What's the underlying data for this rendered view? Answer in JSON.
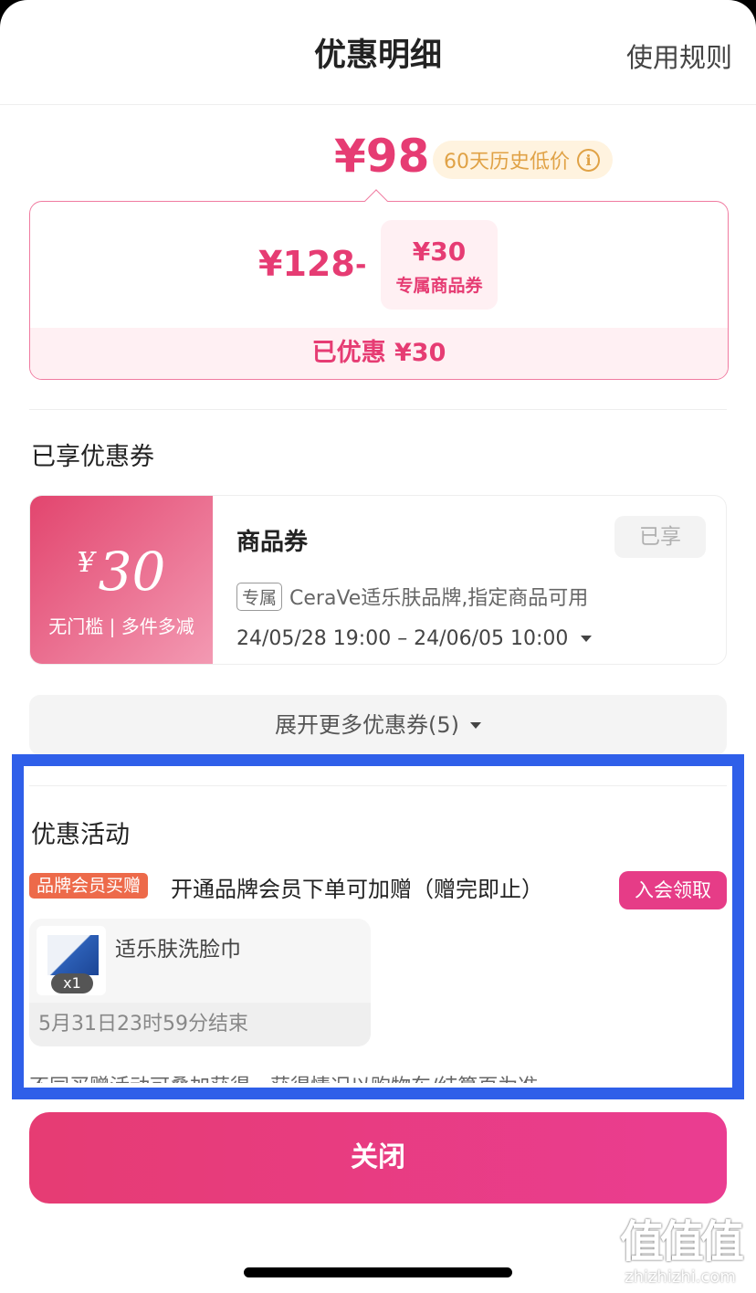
{
  "header": {
    "title": "优惠明细",
    "rules": "使用规则"
  },
  "price": {
    "final": "¥98",
    "lowest_badge": "60天历史低价",
    "original": "¥128",
    "minus": "-",
    "coupon_amount": "¥30",
    "coupon_label": "专属商品券",
    "saved": "已优惠 ¥30"
  },
  "coupons_section": {
    "title": "已享优惠券"
  },
  "coupon": {
    "yen": "¥",
    "amount": "30",
    "condition": "无门槛 | 多件多减",
    "name": "商品券",
    "status": "已享",
    "tag": "专属",
    "scope": "CeraVe适乐肤品牌,指定商品可用",
    "validity": "24/05/28 19:00 – 24/06/05 10:00"
  },
  "expand": {
    "label": "展开更多优惠券(5)"
  },
  "activity_section": {
    "title": "优惠活动"
  },
  "activity": {
    "tag": "品牌会员买赠",
    "desc": "开通品牌会员下单可加赠（赠完即止）",
    "join": "入会领取",
    "gift_name": "适乐肤洗脸巾",
    "gift_qty": "x1",
    "gift_end": "5月31日23时59分结束",
    "note": "不同买赠活动可叠加获得，获得情况以购物车/结算页为准"
  },
  "close": {
    "label": "关闭"
  },
  "watermark": {
    "big": "值值值",
    "small": "zhizhizhi.com"
  },
  "colors": {
    "accent": "#e63c73",
    "highlight": "#2f5fe9",
    "badge_bg": "#fff3df",
    "badge_text": "#e0a246"
  }
}
